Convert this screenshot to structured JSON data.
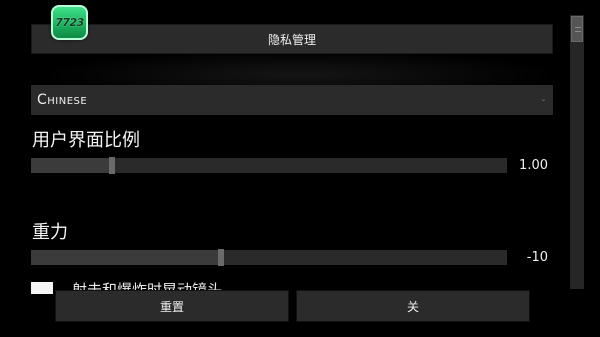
{
  "logo": {
    "text": "7723"
  },
  "privacy_button": {
    "label": "隐私管理"
  },
  "language": {
    "selected": "Chinese",
    "arrow_icon": "dropdown-arrow-icon"
  },
  "ui_scale": {
    "label": "用户界面比例",
    "value_text": "1.00",
    "slider_level": 0.17
  },
  "gravity": {
    "label": "重力",
    "value_text": "-10",
    "slider_level": 0.4
  },
  "shake_option": {
    "label": "射击和爆炸时晃动镜头",
    "checked": false
  },
  "footer": {
    "reset_label": "重置",
    "close_label": "关"
  },
  "scrollbar": {
    "position": 0
  },
  "colors": {
    "background": "#000000",
    "panel": "#2b2b2b",
    "logo_green": "#1bb35f"
  }
}
